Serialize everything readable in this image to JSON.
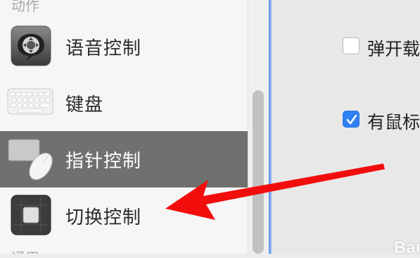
{
  "sidebar": {
    "section_top": "动作",
    "section_bottom": "通用",
    "items": [
      {
        "label": "语音控制",
        "icon": "voice-control-icon"
      },
      {
        "label": "键盘",
        "icon": "keyboard-icon"
      },
      {
        "label": "指针控制",
        "icon": "pointer-control-icon",
        "selected": true
      },
      {
        "label": "切换控制",
        "icon": "switch-control-icon"
      }
    ]
  },
  "main": {
    "options": [
      {
        "label": "弹开载",
        "checked": false
      },
      {
        "label": "有鼠标",
        "checked": true
      }
    ]
  },
  "annotation": {
    "type": "red-arrow",
    "target": "切换控制"
  },
  "watermark": "Bai",
  "colors": {
    "accent": "#2f80f5",
    "selected_row": "#707070",
    "arrow": "#f20d0d"
  }
}
